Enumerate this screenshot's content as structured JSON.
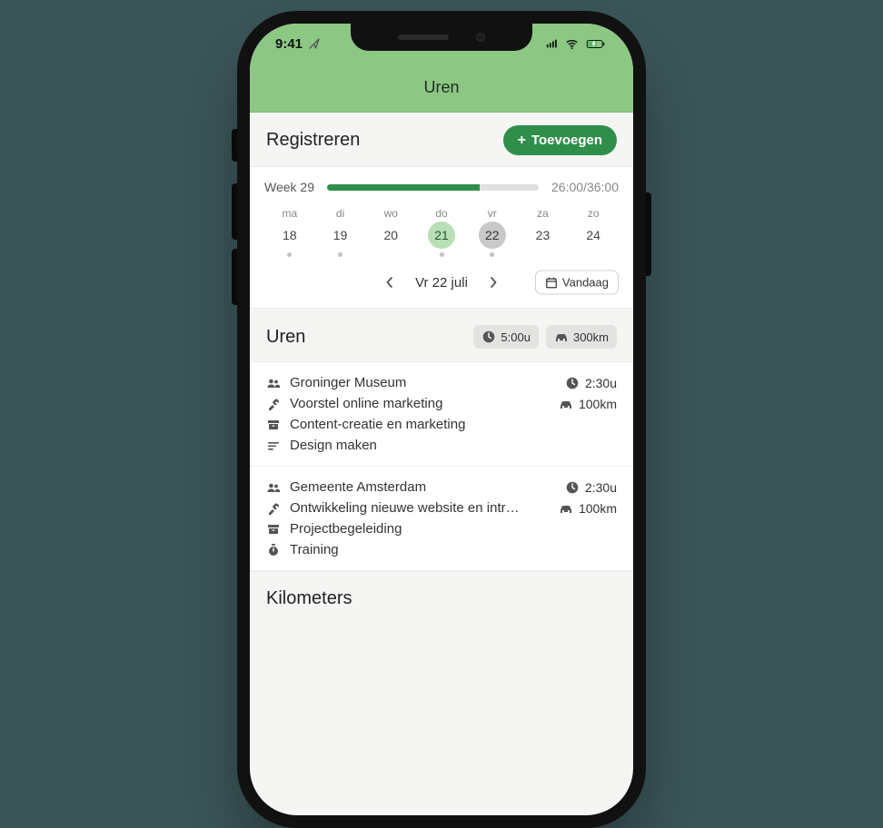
{
  "status": {
    "time": "9:41"
  },
  "header": {
    "title": "Uren"
  },
  "register": {
    "title": "Registreren",
    "add_label": "Toevoegen"
  },
  "week": {
    "label": "Week 29",
    "hours_done": "26:00",
    "hours_total": "36:00",
    "progress_pct": 72,
    "days": [
      {
        "abbr": "ma",
        "num": "18",
        "has_dot": true,
        "current": false,
        "selected": false
      },
      {
        "abbr": "di",
        "num": "19",
        "has_dot": true,
        "current": false,
        "selected": false
      },
      {
        "abbr": "wo",
        "num": "20",
        "has_dot": false,
        "current": false,
        "selected": false
      },
      {
        "abbr": "do",
        "num": "21",
        "has_dot": true,
        "current": true,
        "selected": false
      },
      {
        "abbr": "vr",
        "num": "22",
        "has_dot": true,
        "current": false,
        "selected": true
      },
      {
        "abbr": "za",
        "num": "23",
        "has_dot": false,
        "current": false,
        "selected": false
      },
      {
        "abbr": "zo",
        "num": "24",
        "has_dot": false,
        "current": false,
        "selected": false
      }
    ],
    "selected_date_label": "Vr 22 juli",
    "today_label": "Vandaag"
  },
  "hours": {
    "title": "Uren",
    "total_duration": "5:00u",
    "total_distance": "300km",
    "entries": [
      {
        "client": "Groninger Museum",
        "project": "Voorstel online marketing",
        "category": "Content-creatie en marketing",
        "task": "Design maken",
        "duration": "2:30u",
        "distance": "100km"
      },
      {
        "client": "Gemeente Amsterdam",
        "project": "Ontwikkeling nieuwe website en intrane...",
        "category": "Projectbegeleiding",
        "task": "Training",
        "duration": "2:30u",
        "distance": "100km"
      }
    ]
  },
  "kilometers": {
    "title": "Kilometers"
  }
}
